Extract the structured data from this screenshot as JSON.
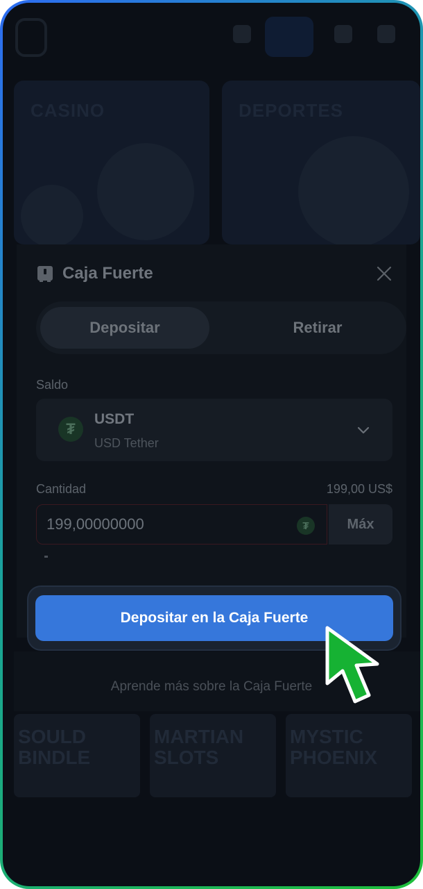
{
  "modal": {
    "title": "Caja Fuerte",
    "tabs": [
      {
        "label": "Depositar",
        "active": true
      },
      {
        "label": "Retirar",
        "active": false
      }
    ],
    "balance_label": "Saldo",
    "currency": {
      "code": "USDT",
      "name": "USD Tether",
      "icon": "tether-icon"
    },
    "amount_label": "Cantidad",
    "amount_fiat": "199,00 US$",
    "amount_value": "199,00000000",
    "max_label": "Máx",
    "deposit_button": "Depositar en la Caja Fuerte",
    "learn_more": "Aprende más sobre la Caja Fuerte"
  },
  "background": {
    "banners": [
      "CASINO",
      "DEPORTES"
    ]
  },
  "colors": {
    "primary_button": "#3677db",
    "cursor_fill": "#16b233",
    "frame_gradient": [
      "#2d6cf2",
      "#1fbf3a"
    ]
  }
}
